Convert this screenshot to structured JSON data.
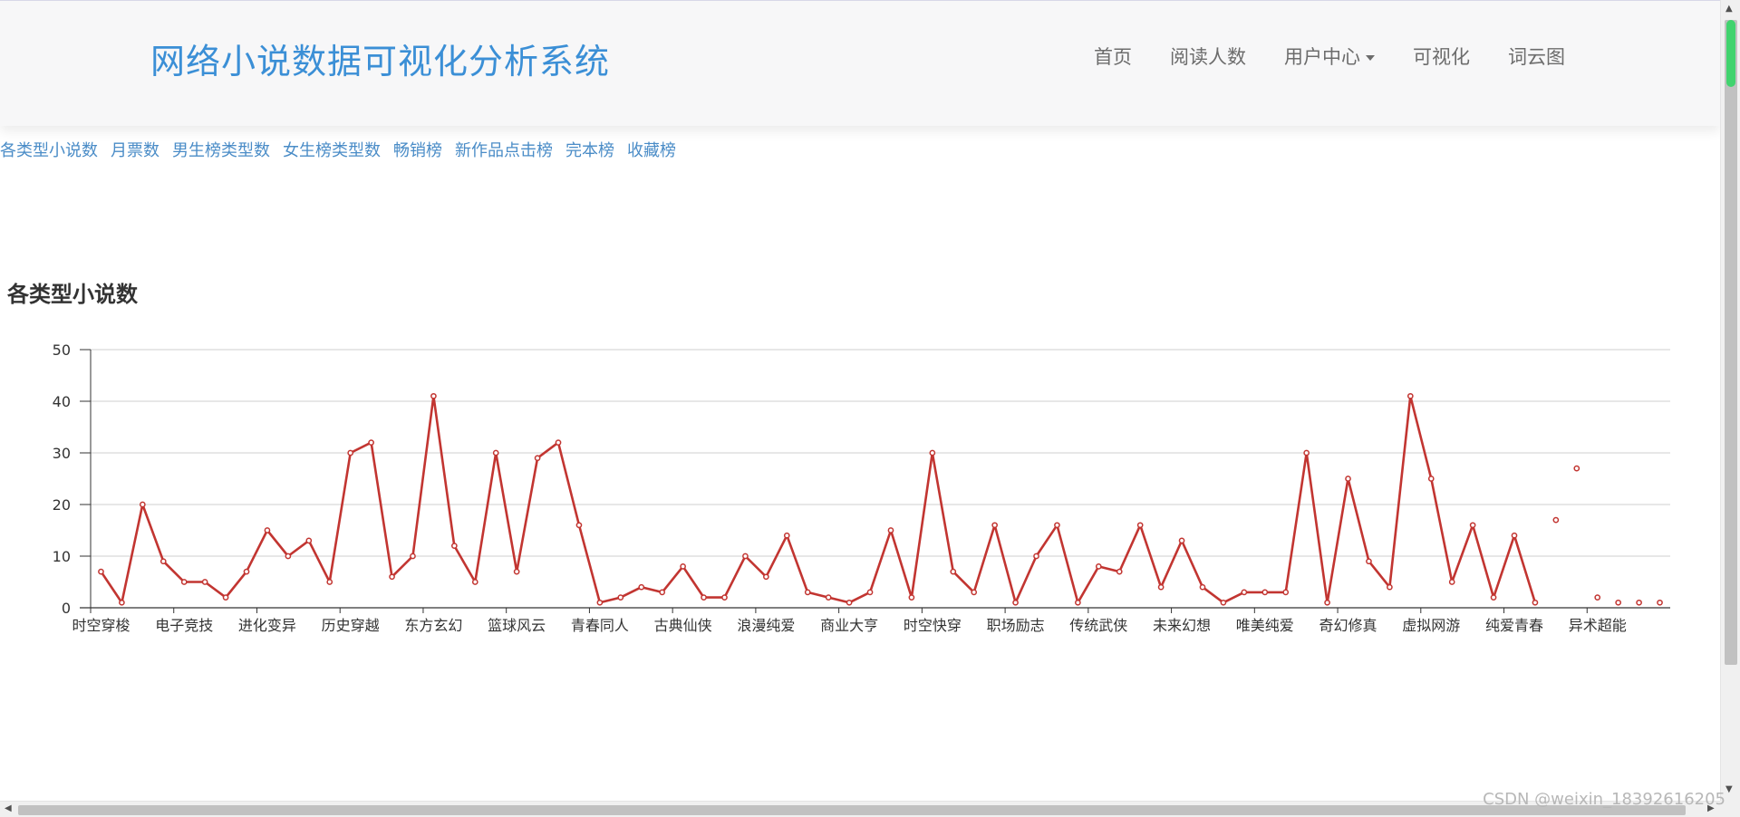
{
  "nav": {
    "brand": "网络小说数据可视化分析系统",
    "items": [
      {
        "label": "首页"
      },
      {
        "label": "阅读人数"
      },
      {
        "label": "用户中心",
        "dropdown": true
      },
      {
        "label": "可视化"
      },
      {
        "label": "词云图"
      }
    ]
  },
  "sublinks": [
    "各类型小说数",
    "月票数",
    "男生榜类型数",
    "女生榜类型数",
    "畅销榜",
    "新作品点击榜",
    "完本榜",
    "收藏榜"
  ],
  "chart_title": "各类型小说数",
  "chart_data": {
    "type": "line",
    "title": "各类型小说数",
    "xlabel": "",
    "ylabel": "",
    "ylim": [
      0,
      50
    ],
    "yticks": [
      0,
      10,
      20,
      30,
      40,
      50
    ],
    "x_tick_labels": [
      "时空穿梭",
      "电子竞技",
      "进化变异",
      "历史穿越",
      "东方玄幻",
      "篮球风云",
      "青春同人",
      "古典仙侠",
      "浪漫纯爱",
      "商业大亨",
      "时空快穿",
      "职场励志",
      "传统武侠",
      "未来幻想",
      "唯美纯爱",
      "奇幻修真",
      "虚拟网游",
      "纯爱青春",
      "异术超能"
    ],
    "label_every": 4,
    "grid": true,
    "line_color": "#c23531",
    "values": [
      7,
      1,
      20,
      9,
      5,
      5,
      2,
      7,
      15,
      10,
      13,
      5,
      30,
      32,
      6,
      10,
      41,
      12,
      5,
      30,
      7,
      29,
      32,
      16,
      1,
      2,
      4,
      3,
      8,
      2,
      2,
      10,
      6,
      14,
      3,
      2,
      1,
      3,
      15,
      2,
      30,
      7,
      3,
      16,
      1,
      10,
      16,
      1,
      8,
      7,
      16,
      4,
      13,
      4,
      1,
      3,
      3,
      3,
      30,
      1,
      25,
      9,
      4,
      41,
      25,
      5,
      16,
      2,
      14,
      1,
      17,
      27,
      2,
      1,
      1,
      1
    ],
    "line_until_index": 69
  },
  "watermark": "CSDN @weixin_18392616205"
}
